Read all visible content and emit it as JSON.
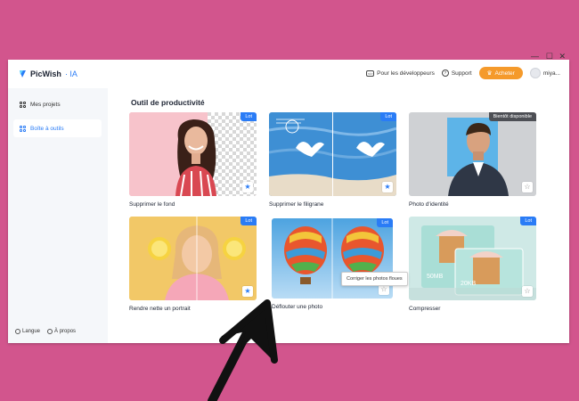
{
  "window": {
    "controls": [
      "—",
      "☐",
      "✕"
    ]
  },
  "app": {
    "name": "PicWish",
    "suffix": "· IA"
  },
  "header": {
    "dev_label": "Pour les développeurs",
    "support_label": "Support",
    "buy_label": "Acheter",
    "user_label": "miya..."
  },
  "sidebar": {
    "items": [
      {
        "label": "Mes projets"
      },
      {
        "label": "Boîte à outils"
      }
    ],
    "footer": {
      "language": "Langue",
      "about": "À propos"
    }
  },
  "main": {
    "section_title": "Outil de productivité",
    "tooltip": "Corriger les photos floues",
    "cards": [
      {
        "label": "Supprimer le fond",
        "badge": "Lot",
        "starred": true
      },
      {
        "label": "Supprimer le filigrane",
        "badge": "Lot",
        "starred": true
      },
      {
        "label": "Photo d'identité",
        "badge": "Bientôt disponible",
        "starred": false
      },
      {
        "label": "Rendre nette un portrait",
        "badge": "Lot",
        "starred": true
      },
      {
        "label": "Déflouter une photo",
        "badge": "Lot",
        "starred": false
      },
      {
        "label": "Compresser",
        "badge": "Lot",
        "starred": false,
        "sizes": [
          "50MB",
          "20KB"
        ]
      }
    ]
  },
  "colors": {
    "accent": "#2a7cf6",
    "buy": "#f59a2b",
    "background": "#d2558d",
    "arrow": "#111111"
  },
  "icons": {
    "star": "star-icon",
    "dev": "code-window-icon",
    "support": "chat-icon",
    "crown": "crown-icon"
  }
}
